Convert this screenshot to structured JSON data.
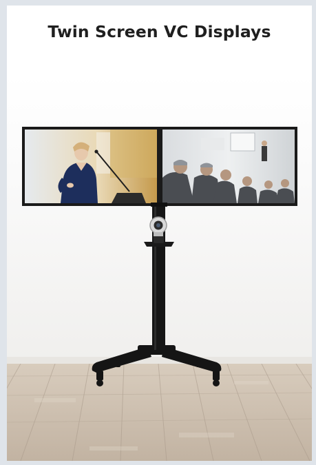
{
  "card": {
    "title": "Twin Screen VC Displays"
  },
  "image": {
    "subject": "dual-display-mobile-stand-photo",
    "colors": {
      "page_border": "#dfe4ea",
      "wall": "#f7f7f5",
      "floor": "#cdbfae",
      "stand": "#151515",
      "bezel": "#1a1a1a"
    }
  }
}
